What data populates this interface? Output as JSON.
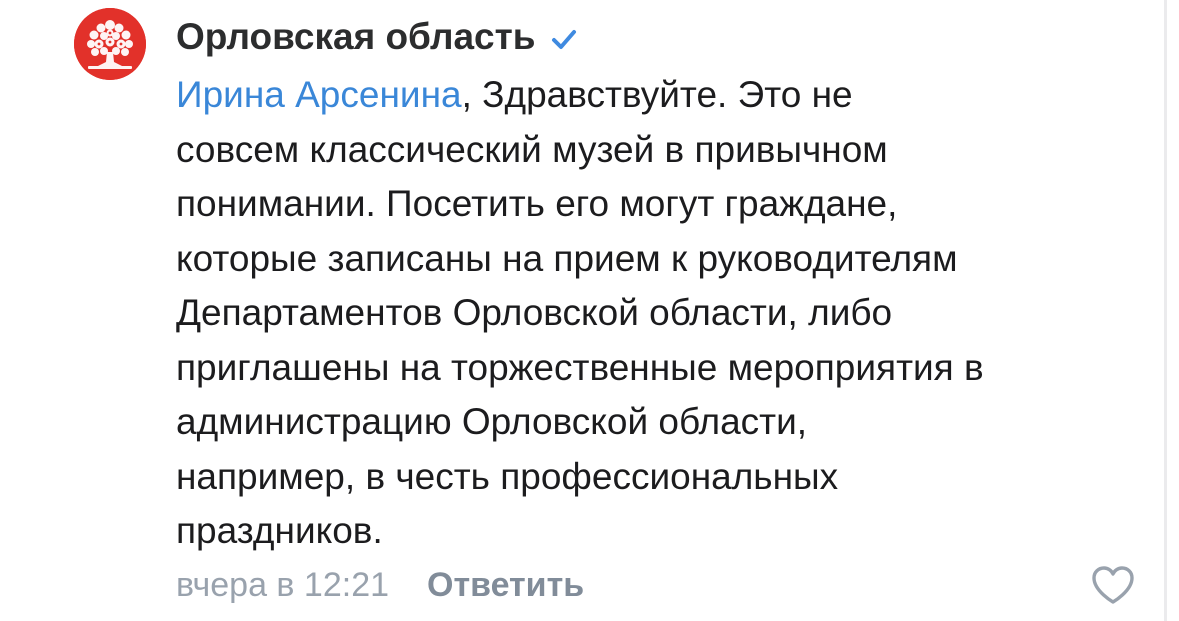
{
  "comment": {
    "author": "Орловская область",
    "verified_icon": "verified-check-icon",
    "avatar_icon": "tree-logo-icon",
    "mention": "Ирина Арсенина",
    "text_lines": [
      ", Здравствуйте.  Это не",
      "совсем классический музей в привычном",
      "понимании. Посетить его могут граждане,",
      "которые записаны на прием к руководителям",
      "Департаментов Орловской области, либо",
      "приглашены на торжественные мероприятия в",
      "администрацию Орловской области,",
      "например, в честь профессиональных",
      "праздников."
    ],
    "timestamp": "вчера в 12:21",
    "reply_label": "Ответить",
    "like_icon": "heart-icon"
  },
  "colors": {
    "mention": "#3a87d8",
    "verified": "#3f8ae0",
    "avatar_bg": "#e2312a",
    "meta": "#99a2ad"
  }
}
